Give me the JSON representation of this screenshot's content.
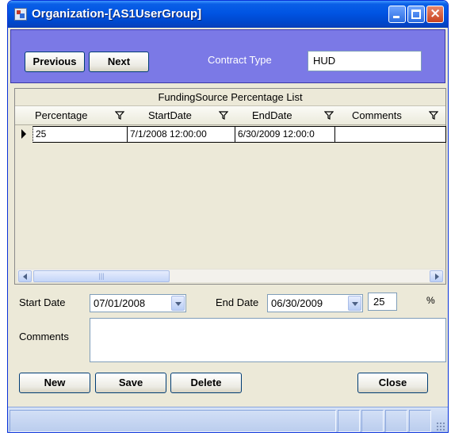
{
  "window": {
    "title": "Organization-[AS1UserGroup]"
  },
  "top_panel": {
    "previous_label": "Previous",
    "next_label": "Next",
    "contract_type_label": "Contract Type",
    "contract_type_value": "HUD"
  },
  "grid": {
    "caption": "FundingSource Percentage List",
    "columns": [
      "Percentage",
      "StartDate",
      "EndDate",
      "Comments"
    ],
    "rows": [
      {
        "percentage": "25",
        "start_date": "7/1/2008 12:00:00",
        "end_date": "6/30/2009 12:00:0",
        "comments": ""
      }
    ]
  },
  "form": {
    "start_date_label": "Start Date",
    "start_date_value": "07/01/2008",
    "end_date_label": "End Date",
    "end_date_value": "06/30/2009",
    "percentage_value": "25",
    "percent_sign": "%",
    "comments_label": "Comments",
    "comments_value": ""
  },
  "buttons": {
    "new": "New",
    "save": "Save",
    "delete": "Delete",
    "close": "Close"
  },
  "icons": {
    "app": "app-icon",
    "filter": "filter-icon",
    "row_pointer": "row-pointer-icon",
    "dropdown": "chevron-down-icon"
  },
  "colors": {
    "title_bar": "#0054e3",
    "top_panel": "#7b79e6",
    "window_bg": "#ece9d8",
    "status_bar": "#c6d6f2"
  }
}
